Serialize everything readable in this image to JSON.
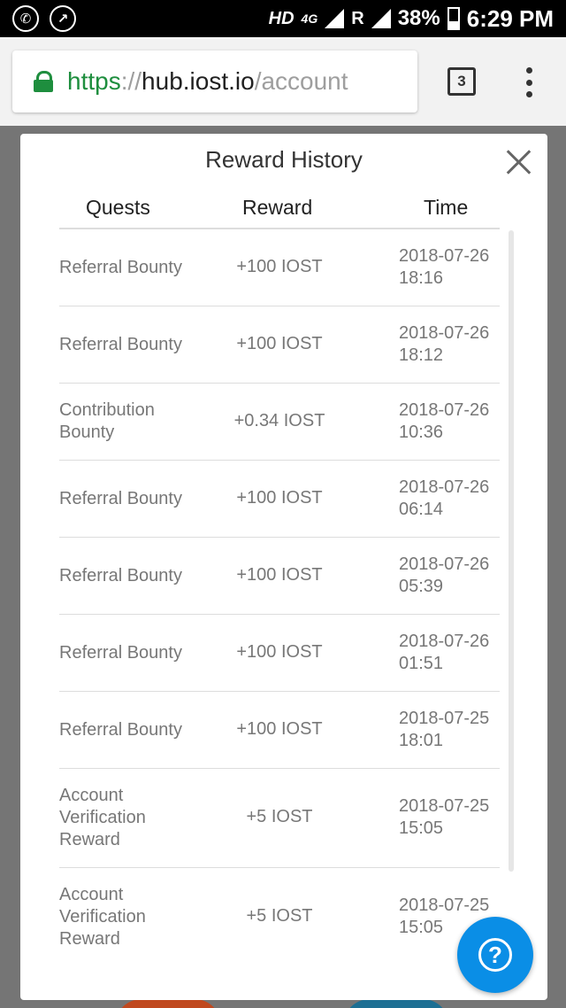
{
  "status_bar": {
    "left_icons": [
      "whatsapp-icon",
      "phone-missed-icon"
    ],
    "network_hd": "HD",
    "network_type": "4G",
    "roaming": "R",
    "battery_percent": "38%",
    "time": "6:29 PM"
  },
  "browser": {
    "url_scheme": "https",
    "url_sep": "://",
    "url_host": "hub.iost.io",
    "url_path": "/account",
    "tab_count": "3"
  },
  "modal": {
    "title": "Reward History",
    "columns": {
      "quests": "Quests",
      "reward": "Reward",
      "time": "Time"
    },
    "rows": [
      {
        "quest": "Referral Bounty",
        "reward": "+100 IOST",
        "date": "2018-07-26",
        "clock": "18:16"
      },
      {
        "quest": "Referral Bounty",
        "reward": "+100 IOST",
        "date": "2018-07-26",
        "clock": "18:12"
      },
      {
        "quest": "Contribution Bounty",
        "reward": "+0.34 IOST",
        "date": "2018-07-26",
        "clock": "10:36"
      },
      {
        "quest": "Referral Bounty",
        "reward": "+100 IOST",
        "date": "2018-07-26",
        "clock": "06:14"
      },
      {
        "quest": "Referral Bounty",
        "reward": "+100 IOST",
        "date": "2018-07-26",
        "clock": "05:39"
      },
      {
        "quest": "Referral Bounty",
        "reward": "+100 IOST",
        "date": "2018-07-26",
        "clock": "01:51"
      },
      {
        "quest": "Referral Bounty",
        "reward": "+100 IOST",
        "date": "2018-07-25",
        "clock": "18:01"
      },
      {
        "quest": "Account Verification Reward",
        "reward": "+5 IOST",
        "date": "2018-07-25",
        "clock": "15:05"
      },
      {
        "quest": "Account Verification Reward",
        "reward": "+5 IOST",
        "date": "2018-07-25",
        "clock": "15:05"
      }
    ]
  },
  "help_button": {
    "label": "?"
  }
}
